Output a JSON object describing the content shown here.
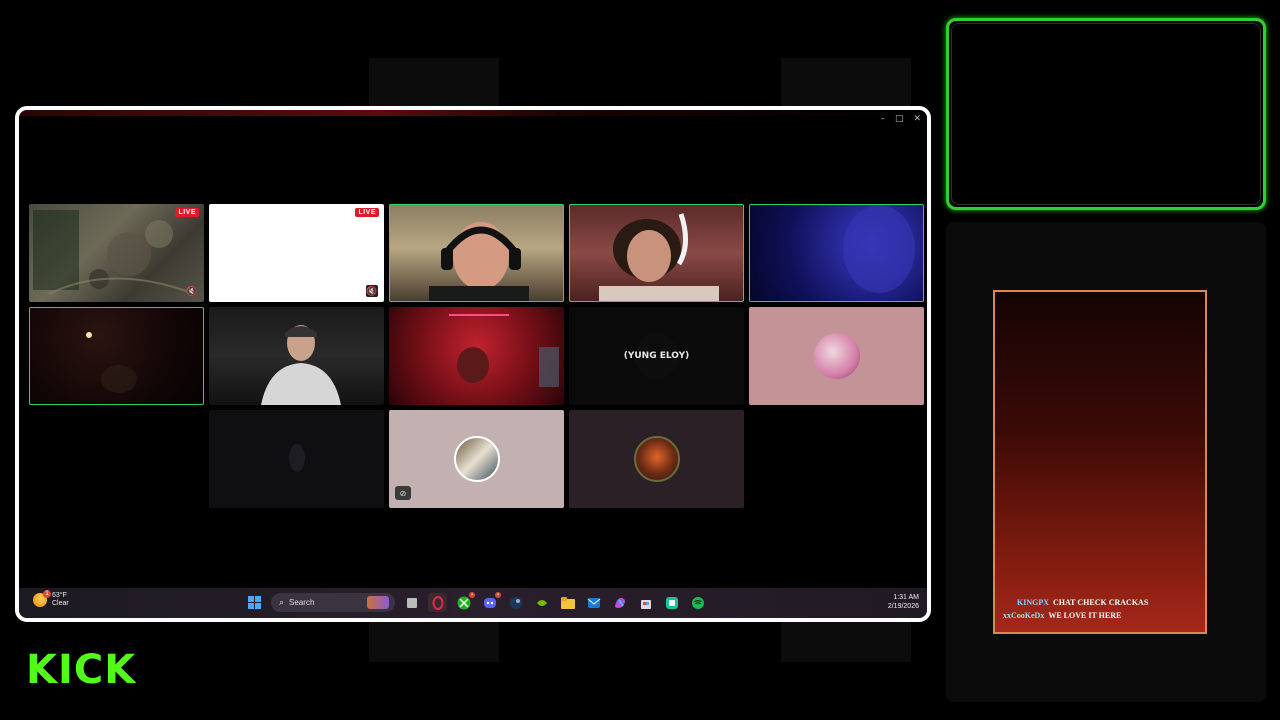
{
  "window": {
    "controls": {
      "minimize": "–",
      "maximize": "□",
      "close": "✕"
    }
  },
  "tiles": [
    {
      "id": "map",
      "badge": "LIVE",
      "muted": true
    },
    {
      "id": "white",
      "badge": "LIVE",
      "muted": true
    },
    {
      "id": "headset-man",
      "speaking": true
    },
    {
      "id": "curly-hair",
      "speaking": true
    },
    {
      "id": "blue-light",
      "speaking": true
    },
    {
      "id": "dark-room",
      "speaking": true
    },
    {
      "id": "hoodie-man"
    },
    {
      "id": "red-room"
    },
    {
      "id": "yung-eloy",
      "name": "(YUNG ELOY)"
    },
    {
      "id": "pink-avatar"
    },
    {
      "id": "dark-figure"
    },
    {
      "id": "group-avatar",
      "camera_off": true
    },
    {
      "id": "logo-avatar"
    }
  ],
  "taskbar": {
    "weather": {
      "temp": "63°F",
      "condition": "Clear",
      "badge": "1"
    },
    "search_label": "Search",
    "time": "1:31 AM",
    "date": "2/19/2026"
  },
  "chat": {
    "messages": [
      {
        "user": "KINGPX",
        "text": "CHAT CHECK CRACKAS"
      },
      {
        "user": "xxCooKeDx",
        "text": "WE LOVE IT HERE"
      }
    ]
  },
  "brand": {
    "logo": "KICK",
    "accent": "#53fc18"
  }
}
